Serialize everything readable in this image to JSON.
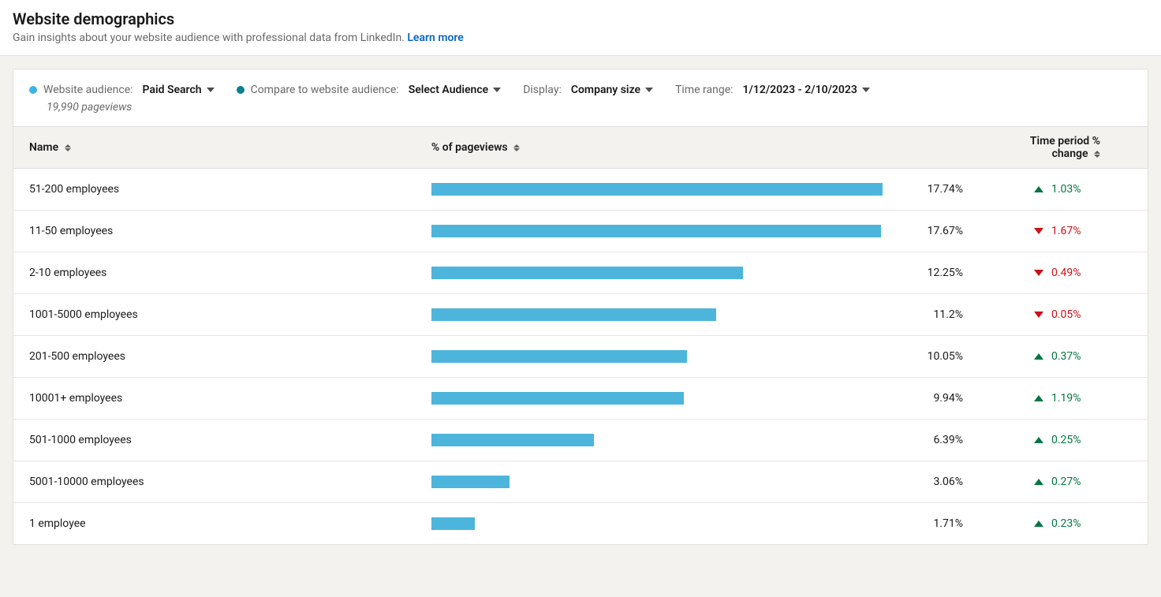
{
  "header": {
    "title": "Website demographics",
    "subtitle_prefix": "Gain insights about your website audience with professional data from LinkedIn. ",
    "learn_more": "Learn more"
  },
  "controls": {
    "website_audience_label": "Website audience:",
    "website_audience_value": "Paid Search",
    "compare_label": "Compare to website audience:",
    "compare_value": "Select Audience",
    "display_label": "Display:",
    "display_value": "Company size",
    "time_range_label": "Time range:",
    "time_range_value": "1/12/2023 - 2/10/2023",
    "pageviews_text": "19,990 pageviews"
  },
  "columns": {
    "name": "Name",
    "pct": "% of pageviews",
    "change": "Time period % change"
  },
  "rows": [
    {
      "name": "51-200 employees",
      "pct": 17.74,
      "pct_text": "17.74%",
      "change_dir": "up",
      "change_text": "1.03%"
    },
    {
      "name": "11-50 employees",
      "pct": 17.67,
      "pct_text": "17.67%",
      "change_dir": "down",
      "change_text": "1.67%"
    },
    {
      "name": "2-10 employees",
      "pct": 12.25,
      "pct_text": "12.25%",
      "change_dir": "down",
      "change_text": "0.49%"
    },
    {
      "name": "1001-5000 employees",
      "pct": 11.2,
      "pct_text": "11.2%",
      "change_dir": "down",
      "change_text": "0.05%"
    },
    {
      "name": "201-500 employees",
      "pct": 10.05,
      "pct_text": "10.05%",
      "change_dir": "up",
      "change_text": "0.37%"
    },
    {
      "name": "10001+ employees",
      "pct": 9.94,
      "pct_text": "9.94%",
      "change_dir": "up",
      "change_text": "1.19%"
    },
    {
      "name": "501-1000 employees",
      "pct": 6.39,
      "pct_text": "6.39%",
      "change_dir": "up",
      "change_text": "0.25%"
    },
    {
      "name": "5001-10000 employees",
      "pct": 3.06,
      "pct_text": "3.06%",
      "change_dir": "up",
      "change_text": "0.27%"
    },
    {
      "name": "1 employee",
      "pct": 1.71,
      "pct_text": "1.71%",
      "change_dir": "up",
      "change_text": "0.23%"
    }
  ],
  "chart_data": {
    "type": "bar",
    "title": "Website demographics — % of pageviews by Company size",
    "xlabel": "% of pageviews",
    "ylabel": "Company size",
    "categories": [
      "51-200 employees",
      "11-50 employees",
      "2-10 employees",
      "1001-5000 employees",
      "201-500 employees",
      "10001+ employees",
      "501-1000 employees",
      "5001-10000 employees",
      "1 employee"
    ],
    "values": [
      17.74,
      17.67,
      12.25,
      11.2,
      10.05,
      9.94,
      6.39,
      3.06,
      1.71
    ],
    "series": [
      {
        "name": "% of pageviews",
        "values": [
          17.74,
          17.67,
          12.25,
          11.2,
          10.05,
          9.94,
          6.39,
          3.06,
          1.71
        ]
      },
      {
        "name": "Time period % change",
        "values": [
          1.03,
          -1.67,
          -0.49,
          -0.05,
          0.37,
          1.19,
          0.25,
          0.27,
          0.23
        ]
      }
    ],
    "xlim": [
      0,
      18
    ]
  }
}
